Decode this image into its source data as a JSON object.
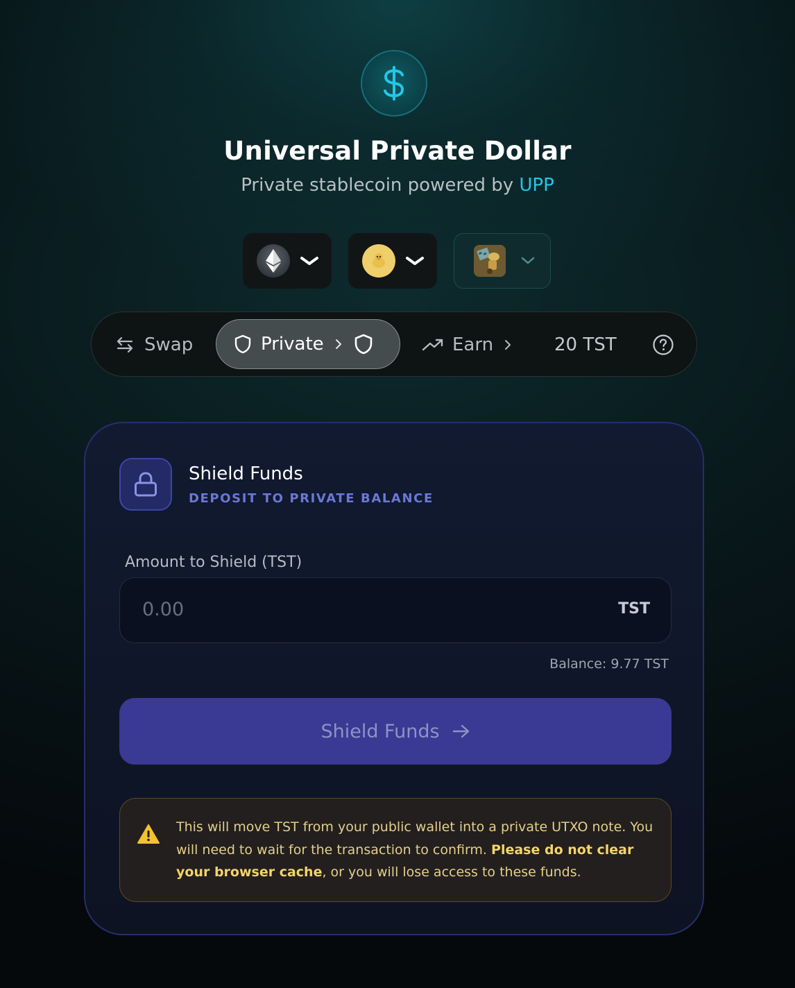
{
  "header": {
    "logo_symbol": "$",
    "title": "Universal Private Dollar",
    "subtitle_prefix": "Private stablecoin powered by",
    "subtitle_brand": "UPP"
  },
  "selectors": [
    {
      "icon": "ethereum-icon",
      "chevron": "chevron-down-icon"
    },
    {
      "icon": "duck-token-icon",
      "chevron": "chevron-down-icon"
    },
    {
      "icon": "wallet-avatar-icon",
      "chevron": "chevron-down-icon"
    }
  ],
  "nav": {
    "swap": "Swap",
    "private": "Private",
    "earn": "Earn",
    "balance": "20 TST"
  },
  "card": {
    "title": "Shield Funds",
    "subtitle": "DEPOSIT TO PRIVATE BALANCE",
    "amount_label": "Amount to Shield (TST)",
    "amount_placeholder": "0.00",
    "amount_value": "",
    "amount_unit": "TST",
    "balance": "Balance: 9.77 TST",
    "button": "Shield Funds",
    "warning_part1": "This will move TST from your public wallet into a private UTXO note. You will need to wait for the transaction to confirm. ",
    "warning_bold": "Please do not clear your browser cache",
    "warning_part2": ", or you will lose access to these funds."
  },
  "colors": {
    "brand_accent": "#22c7e8",
    "button_bg": "#3a3994",
    "card_border": "#262f6a",
    "warning_text": "#e3cf8d"
  }
}
